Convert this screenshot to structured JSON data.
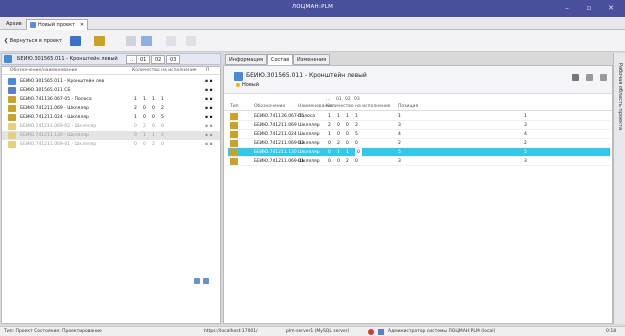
{
  "window": {
    "title": "ЛОЦМАН:PLM",
    "minimize": "–",
    "restore": "▫",
    "close": "✕"
  },
  "tabs": {
    "archive": "Архив",
    "new_project": "Новый проект",
    "close_glyph": "✕"
  },
  "toolbar": {
    "back_label": "Вернуться в проект"
  },
  "left": {
    "header_tabs": [
      "БЕИЮ.301565.011 - Кронштейн левый",
      "…",
      "01",
      "02",
      "03"
    ],
    "col_name": "Обозначение/наименование",
    "col_qty": "Количество на исполнение",
    "col_sep": "П",
    "rows": [
      {
        "indent": 1,
        "label": "БЕИЮ.301565.011 - Кронштейн лев",
        "qty": [
          "",
          "",
          "",
          ""
        ],
        "flags": "▪ ▪",
        "icon": "#4a8ad8",
        "grey": false,
        "sel": false
      },
      {
        "indent": 1,
        "label": "БЕИЮ.301565.011 СБ",
        "qty": [
          "",
          "",
          "",
          ""
        ],
        "flags": "▪ ▪",
        "icon": "#5a7fc8",
        "grey": false,
        "sel": false
      },
      {
        "indent": 1,
        "label": "БЕИЮ.741136.067-05 - Полоса",
        "qty": [
          "1",
          "1",
          "1",
          "1"
        ],
        "flags": "▪ ▪",
        "icon": "#c9a227",
        "grey": false,
        "sel": false
      },
      {
        "indent": 1,
        "label": "БЕИЮ.741211.069 - Шкляляр",
        "qty": [
          "2",
          "0",
          "0",
          "2"
        ],
        "flags": "▪ ▪",
        "icon": "#c9a227",
        "grey": false,
        "sel": false
      },
      {
        "indent": 1,
        "label": "БЕИЮ.741211.024 - Шкляляр",
        "qty": [
          "1",
          "0",
          "0",
          "5"
        ],
        "flags": "▪ ▪",
        "icon": "#c9a227",
        "grey": false,
        "sel": false
      },
      {
        "indent": 1,
        "label": "БЕИЮ.741211.069-02 - Шкляляр",
        "qty": [
          "0",
          "2",
          "0",
          "0"
        ],
        "flags": "▪ ▪",
        "icon": "#e6cf7a",
        "grey": true,
        "sel": false
      },
      {
        "indent": 1,
        "label": "БЕИЮ.741211.130 - Шкляляр",
        "qty": [
          "0",
          "1",
          "1",
          "0"
        ],
        "flags": "▪ ▪",
        "icon": "#e6cf7a",
        "grey": true,
        "sel": true
      },
      {
        "indent": 1,
        "label": "БЕИЮ.741211.069-01 - Шкляляр",
        "qty": [
          "0",
          "0",
          "2",
          "0"
        ],
        "flags": "▪ ▪",
        "icon": "#e6cf7a",
        "grey": true,
        "sel": false
      }
    ]
  },
  "right": {
    "tabs": [
      "Информация",
      "Состав",
      "Изменения"
    ],
    "card_title": "БЕИЮ.301565.011 - Кронштейн левый",
    "card_status": "Новый",
    "exec_headers": [
      "…",
      "01",
      "02",
      "03"
    ],
    "columns": [
      "Тип",
      "Обозначение",
      "Наименование",
      "Количество на исполнение",
      "Позиция"
    ],
    "rows": [
      {
        "code": "БЕИЮ.741136.067-05",
        "name": "Полоса",
        "qty": [
          "1",
          "1",
          "1",
          "1"
        ],
        "pos": "1",
        "extra": "1",
        "sel": false
      },
      {
        "code": "БЕИЮ.741211.069",
        "name": "Шкляляр",
        "qty": [
          "2",
          "0",
          "0",
          "2"
        ],
        "pos": "3",
        "extra": "3",
        "sel": false
      },
      {
        "code": "БЕИЮ.741211.024",
        "name": "Шкляляр",
        "qty": [
          "1",
          "0",
          "0",
          "5"
        ],
        "pos": "4",
        "extra": "4",
        "sel": false
      },
      {
        "code": "БЕИЮ.741211.069-02",
        "name": "Шкляляр",
        "qty": [
          "0",
          "2",
          "0",
          "0"
        ],
        "pos": "2",
        "extra": "2",
        "sel": false
      },
      {
        "code": "БЕИЮ.741211.130",
        "name": "Шкляляр",
        "qty": [
          "0",
          "1",
          "1",
          "0"
        ],
        "pos": "5",
        "extra": "5",
        "sel": true
      },
      {
        "code": "БЕИЮ.741211.069-01",
        "name": "Шкляляр",
        "qty": [
          "0",
          "0",
          "2",
          "0"
        ],
        "pos": "3",
        "extra": "3",
        "sel": false
      }
    ]
  },
  "sidestrip": {
    "label": "Рабочая область проекта"
  },
  "statusbar": {
    "left": "Тип: Проект  Состояние: Проектирование",
    "url": "https://localhost:17001/",
    "server": "plm-server1 (MySQL server)",
    "user": "Администратор системы ЛОЦМАН:PLM (local)",
    "clock": "0:18"
  }
}
